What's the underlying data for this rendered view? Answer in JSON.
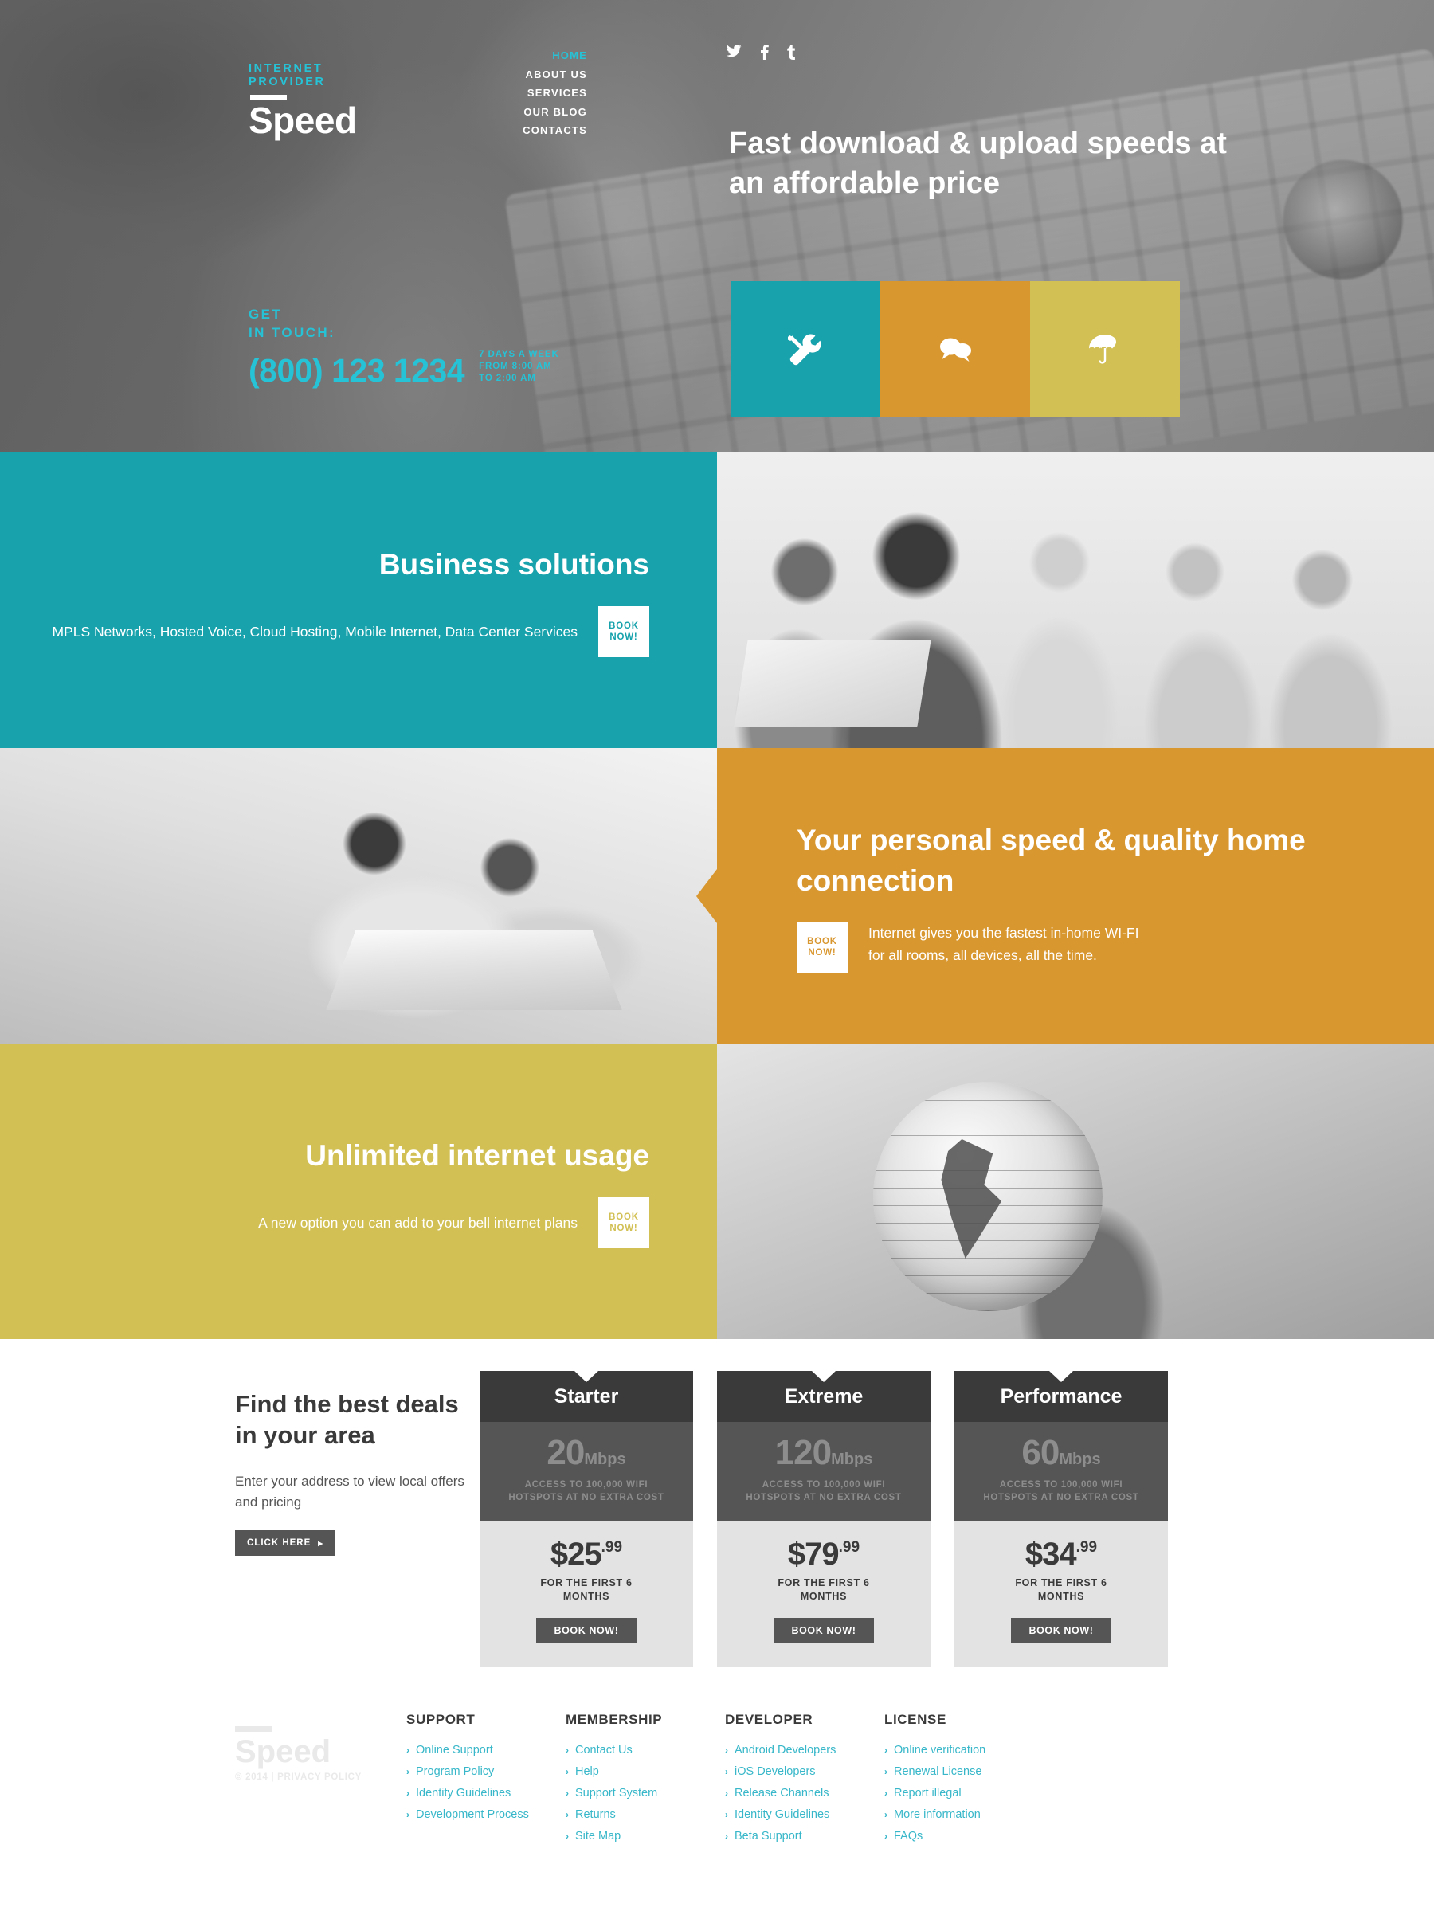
{
  "header": {
    "logo": {
      "kicker_line1": "INTERNET",
      "kicker_line2": "PROVIDER",
      "name": "Speed"
    },
    "nav": [
      {
        "label": "HOME",
        "active": true
      },
      {
        "label": "ABOUT US",
        "active": false
      },
      {
        "label": "SERVICES",
        "active": false
      },
      {
        "label": "OUR BLOG",
        "active": false
      },
      {
        "label": "CONTACTS",
        "active": false
      }
    ],
    "social": [
      {
        "name": "twitter-icon",
        "glyph": "t"
      },
      {
        "name": "facebook-icon",
        "glyph": "f"
      },
      {
        "name": "tumblr-icon",
        "glyph": "t"
      }
    ]
  },
  "hero": {
    "heading": "Fast download & upload speeds at an affordable price",
    "contact_label_line1": "GET",
    "contact_label_line2": "IN TOUCH:",
    "phone": "(800) 123 1234",
    "hours_line1": "7 DAYS A WEEK",
    "hours_line2": "FROM 8:00 AM",
    "hours_line3": "TO 2:00 AM",
    "tiles": [
      {
        "icon": "tools-icon",
        "color": "#17a2ac"
      },
      {
        "icon": "chat-bubbles-icon",
        "color": "#d99730"
      },
      {
        "icon": "umbrella-icon",
        "color": "#d2c055"
      }
    ]
  },
  "bands": [
    {
      "heading": "Business solutions",
      "text": "MPLS Networks, Hosted Voice, Cloud Hosting, Mobile Internet, Data Center Services",
      "cta_line1": "BOOK",
      "cta_line2": "NOW!",
      "color": "#17a2ac"
    },
    {
      "heading": "Your personal speed & quality home connection",
      "text": "Internet gives you the fastest in-home WI-FI for all rooms, all devices, all the time.",
      "cta_line1": "BOOK",
      "cta_line2": "NOW!",
      "color": "#d99730"
    },
    {
      "heading": "Unlimited internet usage",
      "text": "A new option you can add to your bell internet plans",
      "cta_line1": "BOOK",
      "cta_line2": "NOW!",
      "color": "#d2c055"
    }
  ],
  "pricing": {
    "heading": "Find the best deals in your area",
    "description": "Enter your address to view local offers and pricing",
    "cta_label": "CLICK HERE",
    "plans": [
      {
        "name": "Starter",
        "speed": "20",
        "unit": "Mbps",
        "note_line1": "ACCESS TO 100,000 WIFI",
        "note_line2": "HOTSPOTS AT NO EXTRA COST",
        "price": "$25",
        "cents": ".99",
        "price_note_line1": "FOR THE FIRST 6",
        "price_note_line2": "MONTHS",
        "button": "BOOK NOW!"
      },
      {
        "name": "Extreme",
        "speed": "120",
        "unit": "Mbps",
        "note_line1": "ACCESS TO 100,000 WIFI",
        "note_line2": "HOTSPOTS AT NO EXTRA COST",
        "price": "$79",
        "cents": ".99",
        "price_note_line1": "FOR THE FIRST 6",
        "price_note_line2": "MONTHS",
        "button": "BOOK NOW!"
      },
      {
        "name": "Performance",
        "speed": "60",
        "unit": "Mbps",
        "note_line1": "ACCESS TO 100,000 WIFI",
        "note_line2": "HOTSPOTS AT NO EXTRA COST",
        "price": "$34",
        "cents": ".99",
        "price_note_line1": "FOR THE FIRST 6",
        "price_note_line2": "MONTHS",
        "button": "BOOK NOW!"
      }
    ]
  },
  "footer": {
    "brand_name": "Speed",
    "copyright": "© 2014 | PRIVACY POLICY",
    "columns": [
      {
        "title": "SUPPORT",
        "links": [
          "Online Support",
          "Program Policy",
          "Identity Guidelines",
          "Development Process"
        ]
      },
      {
        "title": "MEMBERSHIP",
        "links": [
          "Contact Us",
          "Help",
          "Support System",
          "Returns",
          "Site Map"
        ]
      },
      {
        "title": "DEVELOPER",
        "links": [
          "Android Developers",
          "iOS Developers",
          "Release Channels",
          "Identity Guidelines",
          "Beta Support"
        ]
      },
      {
        "title": "LICENSE",
        "links": [
          "Online verification",
          "Renewal License",
          "Report illegal",
          "More information",
          "FAQs"
        ]
      }
    ]
  },
  "colors": {
    "teal": "#17a2ac",
    "orange": "#d99730",
    "yellow": "#d2c055",
    "accent_cyan": "#26c2d6",
    "link_cyan": "#37b7c9",
    "dark": "#3a3a3a",
    "mid": "#555555"
  }
}
